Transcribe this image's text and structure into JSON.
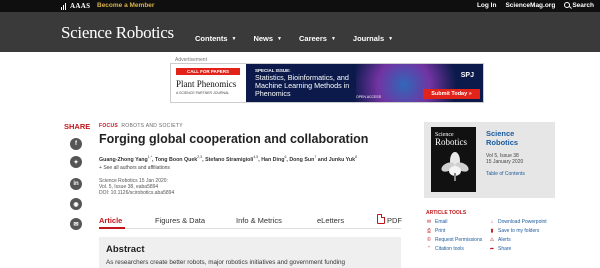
{
  "topbar": {
    "logo_text": "AAAS",
    "become_member": "Become a Member",
    "login": "Log In",
    "sciencemag": "ScienceMag.org",
    "search": "Search"
  },
  "header": {
    "brand": "Science Robotics",
    "nav": [
      {
        "label": "Contents"
      },
      {
        "label": "News"
      },
      {
        "label": "Careers"
      },
      {
        "label": "Journals"
      }
    ]
  },
  "ad": {
    "label": "Advertisement",
    "call_for_papers": "CALL FOR PAPERS",
    "plant_phenomics": "Plant Phenomics",
    "plant_sub": "A SCIENCE PARTNER JOURNAL",
    "special_issue": "SPECIAL ISSUE:",
    "title": "Statistics, Bioinformatics, and Machine Learning Methods in Phenomics",
    "open_access": "OPEN ACCESS",
    "spj": "SPJ",
    "submit": "Submit Today »"
  },
  "share": {
    "label": "SHARE",
    "icons": [
      "facebook-icon",
      "twitter-icon",
      "linkedin-icon",
      "reddit-icon",
      "email-icon"
    ]
  },
  "article": {
    "focus": "FOCUS",
    "category": "ROBOTS AND SOCIETY",
    "title": "Forging global cooperation and collaboration",
    "authors": [
      {
        "name": "Guang-Zhong Yang",
        "sup": "1,*"
      },
      {
        "name": "Tong Boon Quek",
        "sup": "2,3"
      },
      {
        "name": "Stefano Stramigioli",
        "sup": "4,5"
      },
      {
        "name": "Han Ding",
        "sup": "6"
      },
      {
        "name": "Dong Sun",
        "sup": "7"
      },
      {
        "name": "Junku Yuk",
        "sup": "8"
      }
    ],
    "see_all": "See all authors and affiliations",
    "meta_journal": "Science Robotics  15 Jan 2020:",
    "meta_vol": "Vol. 5, Issue 38, eaba5894",
    "meta_doi": "DOI: 10.1126/scirobotics.aba5894",
    "tabs": [
      "Article",
      "Figures & Data",
      "Info & Metrics",
      "eLetters",
      "PDF"
    ],
    "abstract_title": "Abstract",
    "abstract_text": "As researchers create better robots, major robotics initiatives and government funding"
  },
  "journal": {
    "cover_title_1": "Science",
    "cover_title_2": "Robotics",
    "name_1": "Science",
    "name_2": "Robotics",
    "vol_1": "Vol 5, Issue 38",
    "vol_2": "15 January 2020",
    "toc": "Table of Contents"
  },
  "tools": {
    "title": "ARTICLE TOOLS",
    "items": [
      {
        "label": "Email",
        "icon": "email-icon"
      },
      {
        "label": "Download Powerpoint",
        "icon": "download-icon"
      },
      {
        "label": "Print",
        "icon": "print-icon"
      },
      {
        "label": "Save to my folders",
        "icon": "folder-icon"
      },
      {
        "label": "Request Permissions",
        "icon": "permissions-icon"
      },
      {
        "label": "Alerts",
        "icon": "alert-icon"
      },
      {
        "label": "Citation tools",
        "icon": "citation-icon"
      },
      {
        "label": "Share",
        "icon": "share-icon"
      }
    ]
  },
  "colors": {
    "accent_red": "#c0161b",
    "link_blue": "#1a5a9c",
    "header_gray": "#3a3a3a"
  }
}
